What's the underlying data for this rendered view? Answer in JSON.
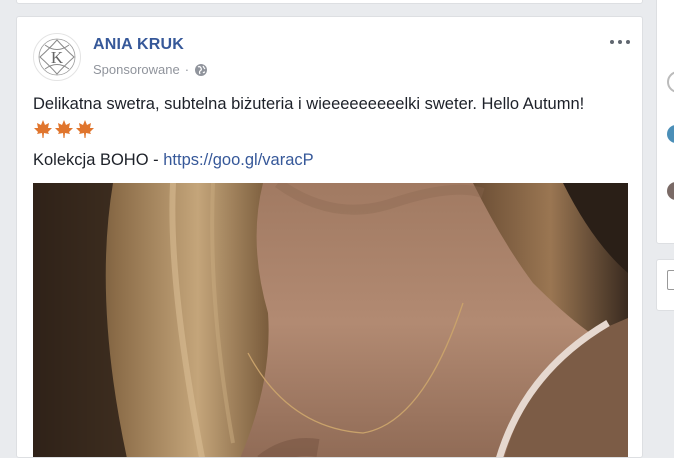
{
  "post": {
    "author": "ANIA KRUK",
    "sponsored_label": "Sponsorowane",
    "separator": "·",
    "text_line1": "Delikatna swetra, subtelna biżuteria i wieeeeeeeeelki sweter. Hello Autumn!",
    "text_line2_prefix": "Kolekcja BOHO - ",
    "link_text": "https://goo.gl/varacP",
    "emoji_count": 3,
    "emoji_icon": "maple-leaf-icon",
    "avatar_letter": "K"
  },
  "colors": {
    "author": "#365899",
    "meta": "#90949c",
    "text": "#1d2129",
    "leaf": "#e0752d",
    "background": "#e9ebee"
  },
  "icons": [
    "more-options-icon",
    "globe-icon",
    "maple-leaf-icon"
  ]
}
